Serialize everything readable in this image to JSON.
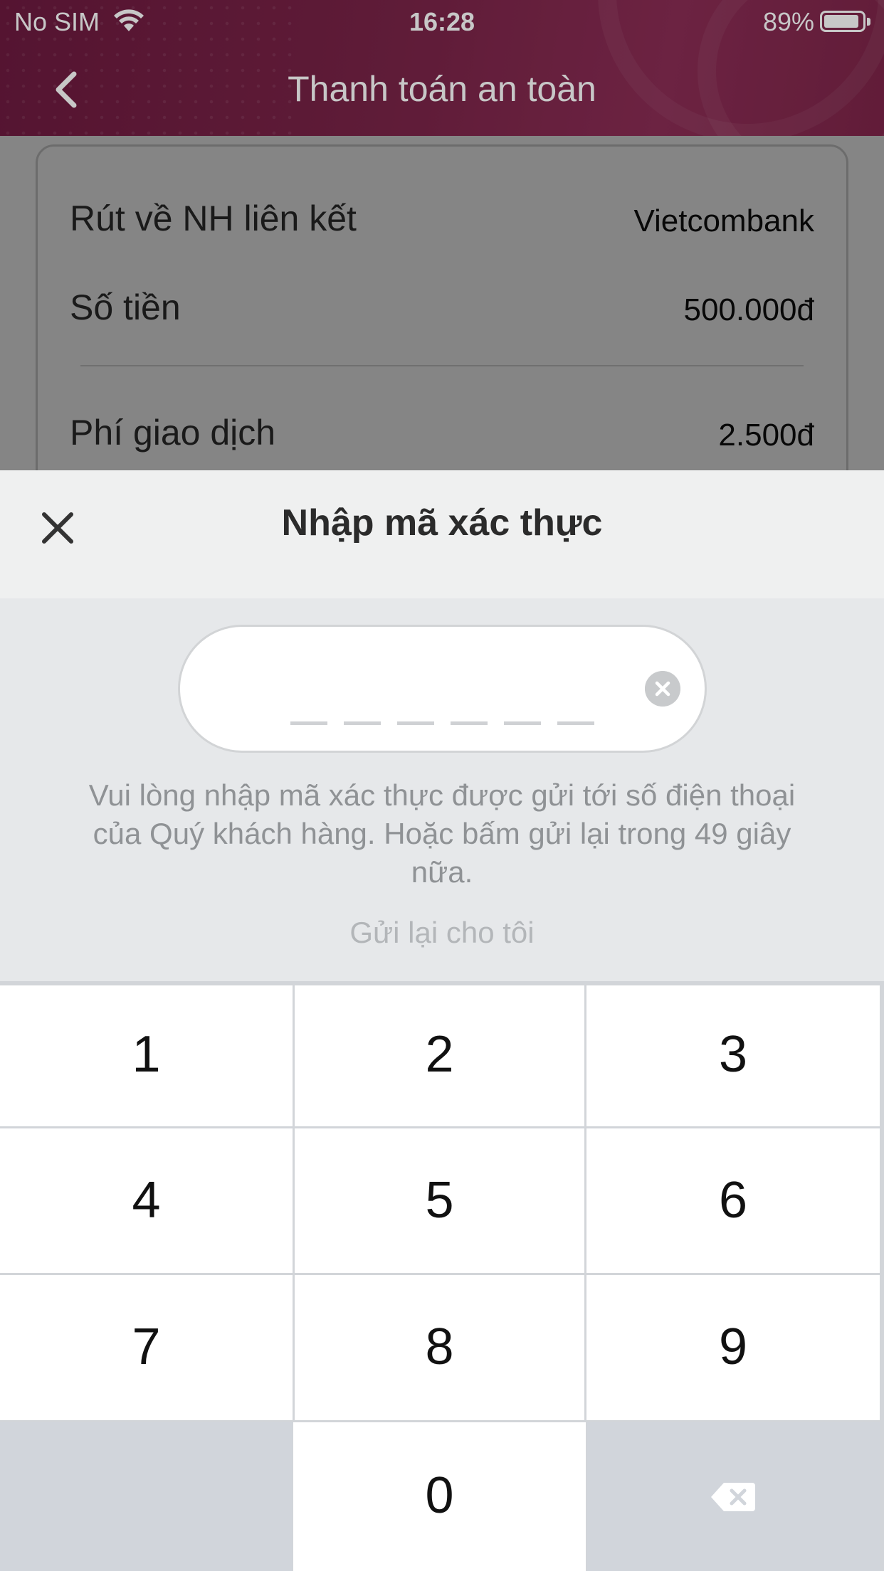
{
  "status_bar": {
    "carrier": "No SIM",
    "time": "16:28",
    "battery": "89%"
  },
  "nav": {
    "title": "Thanh toán an toàn",
    "back_icon": "chevron-left-icon"
  },
  "transaction": {
    "rows": [
      {
        "label": "Rút về NH liên kết",
        "value": "Vietcombank"
      },
      {
        "label": "Số tiền",
        "value": "500.000đ"
      },
      {
        "label": "Phí giao dịch",
        "value": "2.500đ"
      }
    ]
  },
  "otp_sheet": {
    "title": "Nhập mã xác thực",
    "close_icon": "close-icon",
    "clear_icon": "clear-circle-icon",
    "instruction": "Vui lòng nhập mã xác thực được gửi tới số điện thoại của Quý khách hàng. Hoặc bấm gửi lại trong 49 giây nữa.",
    "resend_label": "Gửi lại cho tôi"
  },
  "keypad": {
    "keys": [
      "1",
      "2",
      "3",
      "4",
      "5",
      "6",
      "7",
      "8",
      "9",
      "",
      "0",
      "⌫"
    ],
    "delete_icon": "backspace-icon"
  },
  "colors": {
    "header": "#7a2448",
    "sheet_bg": "#e6e8ea",
    "keypad_bg": "#d2d5d9"
  }
}
